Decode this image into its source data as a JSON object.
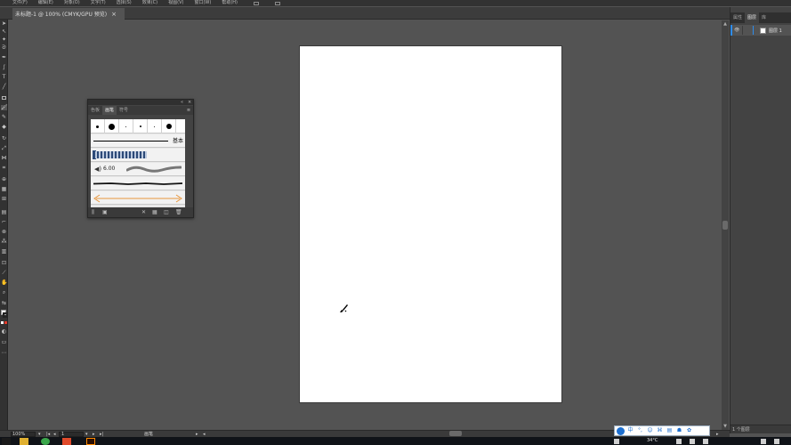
{
  "menubar": {
    "items": [
      "文件(F)",
      "编辑(E)",
      "对象(O)",
      "文字(T)",
      "选择(S)",
      "效果(C)",
      "视图(V)",
      "窗口(W)",
      "帮助(H)"
    ]
  },
  "document": {
    "tab_title": "未标题-1 @ 100% (CMYK/GPU 预览)",
    "close_glyph": "×"
  },
  "brush_panel": {
    "collapse_glyph": "«",
    "close_glyph": "×",
    "tabs": [
      "色板",
      "画笔",
      "符号"
    ],
    "active_tab": "画笔",
    "menu_glyph": "≡",
    "basic_label": "基本",
    "calligraphic_size": "6.00"
  },
  "right_panel": {
    "tabs": [
      "属性",
      "图层",
      "库"
    ],
    "active_tab": "图层",
    "layer_name": "图层 1",
    "footer_text": "1 个图层"
  },
  "statusbar": {
    "zoom": "100%",
    "artboard_number": "1",
    "tool_name": "画笔"
  },
  "taskbar": {
    "clock": "34°C"
  },
  "ime": {
    "items": [
      "中",
      "°,",
      "☺",
      "⌘",
      "▤",
      "☗",
      "✿"
    ]
  },
  "colors": {
    "accent": "#2d8ceb",
    "artboard": "#ffffff",
    "workspace": "#535353",
    "brush_stroke_orange": "#e8963c",
    "pattern_blue": "#2d4a78"
  }
}
